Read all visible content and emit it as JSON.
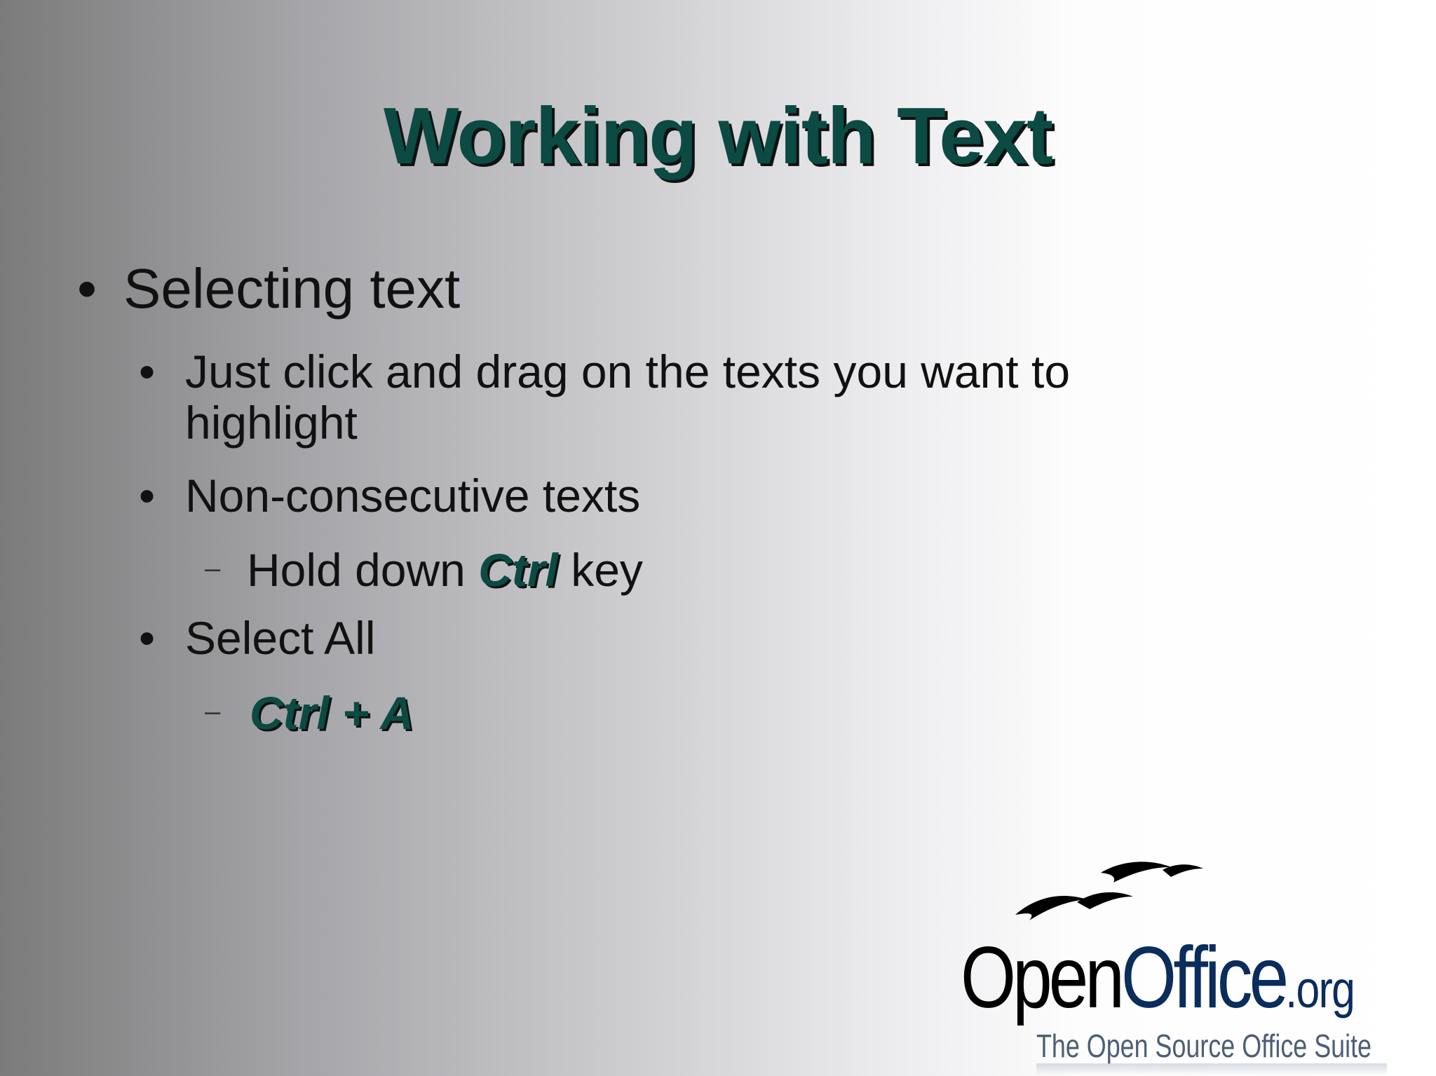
{
  "slide": {
    "title": "Working with Text",
    "bullets": {
      "b1": {
        "marker": "•",
        "text": "Selecting text"
      },
      "b1_1": {
        "marker": "•",
        "line1": "Just click and drag on the texts you want to",
        "line2": "highlight"
      },
      "b1_2": {
        "marker": "•",
        "text": "Non-consecutive texts"
      },
      "b1_2_1": {
        "marker": "–",
        "pre": "Hold down ",
        "key": "Ctrl",
        "post": " key"
      },
      "b1_3": {
        "marker": "•",
        "text": "Select All"
      },
      "b1_3_1": {
        "marker": "–",
        "key": "Ctrl + A"
      }
    }
  },
  "logo": {
    "word_open": "Open",
    "word_office": "Office",
    "word_org": ".org",
    "tagline": "The Open Source Office Suite",
    "icon": "seagulls-logo-icon",
    "colors": {
      "office": "#0a2d5c",
      "tagline": "#4d5e76"
    }
  },
  "colors": {
    "title": "#0c4a44",
    "body_text": "#111111",
    "emphasis": "#0c4a44"
  }
}
